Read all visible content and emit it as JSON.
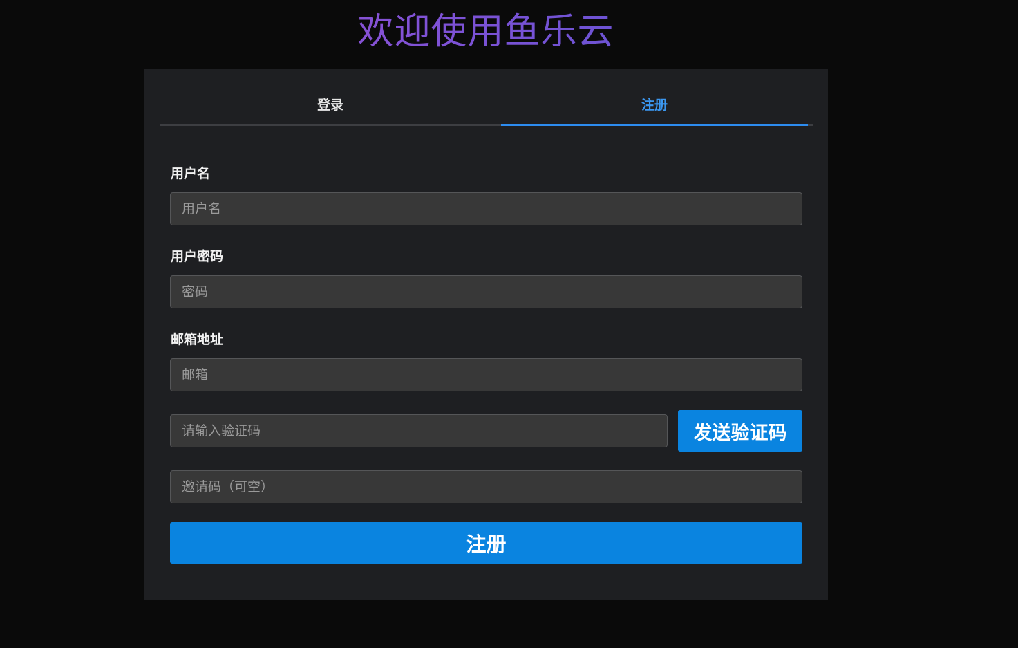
{
  "header": {
    "title": "欢迎使用鱼乐云"
  },
  "tabs": [
    {
      "label": "登录",
      "active": false
    },
    {
      "label": "注册",
      "active": true
    }
  ],
  "form": {
    "username": {
      "label": "用户名",
      "placeholder": "用户名",
      "value": ""
    },
    "password": {
      "label": "用户密码",
      "placeholder": "密码",
      "value": ""
    },
    "email": {
      "label": "邮箱地址",
      "placeholder": "邮箱",
      "value": ""
    },
    "code": {
      "placeholder": "请输入验证码",
      "value": ""
    },
    "invite": {
      "placeholder": "邀请码（可空）",
      "value": ""
    },
    "send_code_label": "发送验证码",
    "submit_label": "注册"
  },
  "colors": {
    "background": "#0a0a0a",
    "card": "#1e1f22",
    "accent": "#0a84e0",
    "active_tab": "#3b97f0",
    "title_gradient": [
      "#a74fd0",
      "#4a55cf"
    ]
  }
}
